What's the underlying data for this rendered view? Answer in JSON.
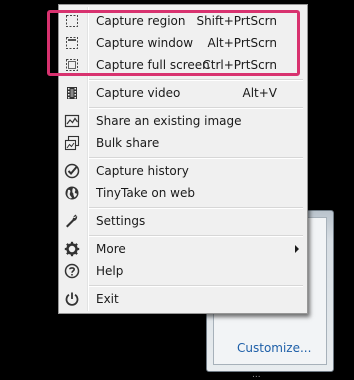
{
  "menu": {
    "items": [
      {
        "label": "Capture region",
        "shortcut": "Shift+PrtScrn",
        "icon": "capture-region-icon"
      },
      {
        "label": "Capture window",
        "shortcut": "Alt+PrtScrn",
        "icon": "capture-window-icon"
      },
      {
        "label": "Capture full screen",
        "shortcut": "Ctrl+PrtScrn",
        "icon": "capture-fullscreen-icon"
      },
      {
        "label": "Capture video",
        "shortcut": "Alt+V",
        "icon": "video-icon"
      },
      {
        "label": "Share an existing image",
        "icon": "image-icon"
      },
      {
        "label": "Bulk share",
        "icon": "bulk-share-icon"
      },
      {
        "label": "Capture history",
        "icon": "check-circle-icon"
      },
      {
        "label": "TinyTake on web",
        "icon": "globe-icon"
      },
      {
        "label": "Settings",
        "icon": "wrench-icon"
      },
      {
        "label": "More",
        "icon": "gear-icon"
      },
      {
        "label": "Help",
        "icon": "question-icon"
      },
      {
        "label": "Exit",
        "icon": "power-icon"
      }
    ]
  },
  "tray_panel": {
    "link": "Customize...",
    "taskbar_text": "..."
  },
  "colors": {
    "highlight": "#d8326f",
    "menu_background": "#f0f0f0",
    "link": "#1e5fa8"
  }
}
